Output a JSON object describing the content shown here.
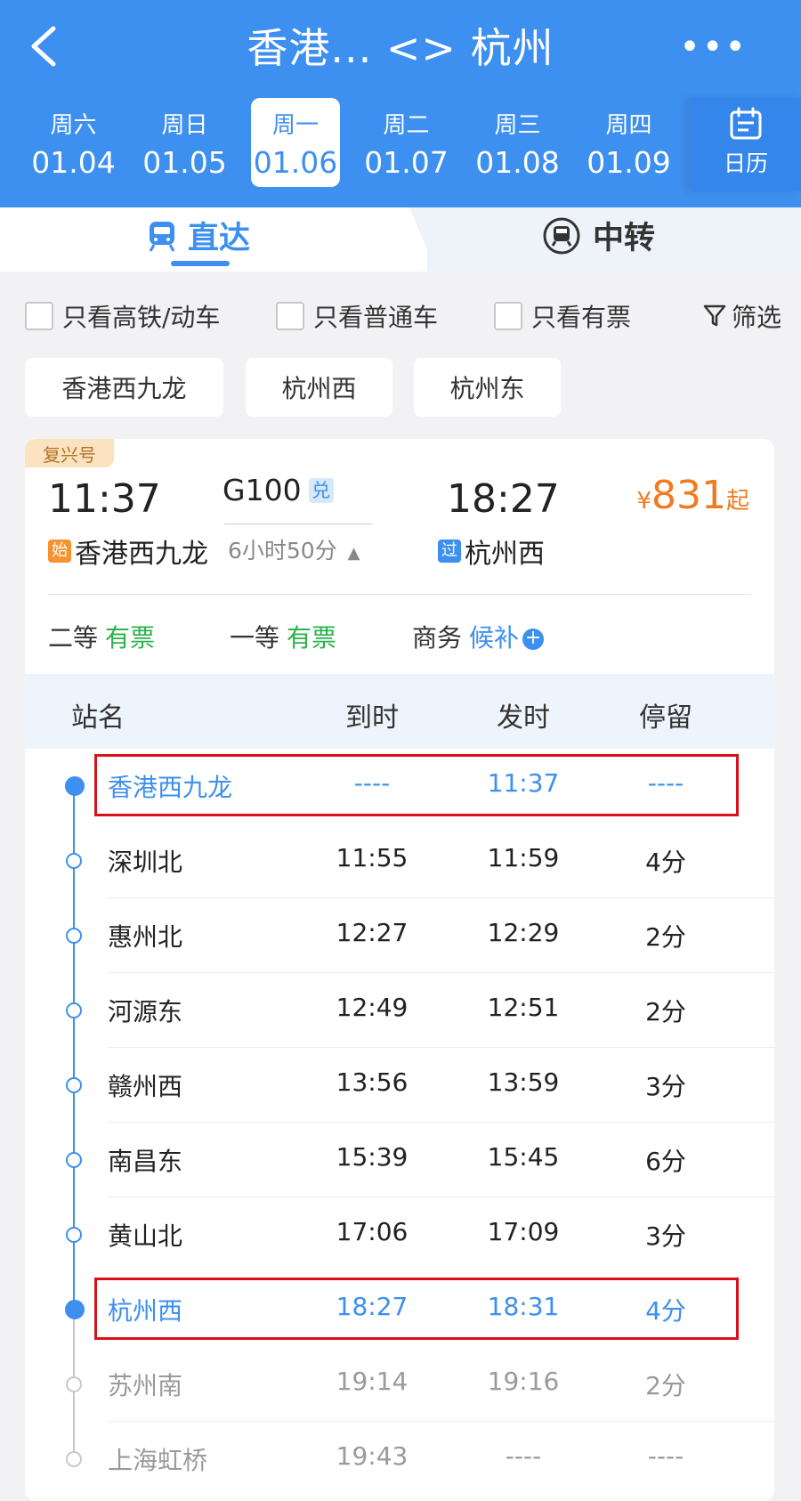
{
  "header": {
    "title": "香港... <> 杭州",
    "more": "•••",
    "dates": [
      {
        "weekday": "周六",
        "date": "01.04"
      },
      {
        "weekday": "周日",
        "date": "01.05"
      },
      {
        "weekday": "周一",
        "date": "01.06",
        "selected": true
      },
      {
        "weekday": "周二",
        "date": "01.07"
      },
      {
        "weekday": "周三",
        "date": "01.08"
      },
      {
        "weekday": "周四",
        "date": "01.09"
      }
    ],
    "calendar_label": "日历"
  },
  "tabs": {
    "direct": "直达",
    "transfer": "中转"
  },
  "filters": {
    "high_speed": "只看高铁/动车",
    "normal": "只看普通车",
    "available": "只看有票",
    "filter": "筛选"
  },
  "station_chips": [
    "香港西九龙",
    "杭州西",
    "杭州东"
  ],
  "train": {
    "badge": "复兴号",
    "depart_time": "11:37",
    "depart_tag": "始",
    "depart_station": "香港西九龙",
    "number": "G100",
    "number_tag": "兑",
    "duration": "6小时50分",
    "arrive_time": "18:27",
    "arrive_tag": "过",
    "arrive_station": "杭州西",
    "price_symbol": "¥",
    "price": "831",
    "price_suffix": "起",
    "seats": [
      {
        "class": "二等",
        "status": "有票"
      },
      {
        "class": "一等",
        "status": "有票"
      },
      {
        "class": "商务",
        "status": "候补"
      }
    ]
  },
  "table": {
    "headers": {
      "station": "站名",
      "arrive": "到时",
      "depart": "发时",
      "stay": "停留"
    },
    "rows": [
      {
        "station": "香港西九龙",
        "arrive": "----",
        "depart": "11:37",
        "stay": "----"
      },
      {
        "station": "深圳北",
        "arrive": "11:55",
        "depart": "11:59",
        "stay": "4分"
      },
      {
        "station": "惠州北",
        "arrive": "12:27",
        "depart": "12:29",
        "stay": "2分"
      },
      {
        "station": "河源东",
        "arrive": "12:49",
        "depart": "12:51",
        "stay": "2分"
      },
      {
        "station": "赣州西",
        "arrive": "13:56",
        "depart": "13:59",
        "stay": "3分"
      },
      {
        "station": "南昌东",
        "arrive": "15:39",
        "depart": "15:45",
        "stay": "6分"
      },
      {
        "station": "黄山北",
        "arrive": "17:06",
        "depart": "17:09",
        "stay": "3分"
      },
      {
        "station": "杭州西",
        "arrive": "18:27",
        "depart": "18:31",
        "stay": "4分"
      },
      {
        "station": "苏州南",
        "arrive": "19:14",
        "depart": "19:16",
        "stay": "2分"
      },
      {
        "station": "上海虹桥",
        "arrive": "19:43",
        "depart": "----",
        "stay": "----"
      }
    ]
  },
  "colors": {
    "accent": "#3d8ff0",
    "price": "#f07a1f",
    "available": "#2bb24c",
    "highlight_box": "#d9121a"
  }
}
